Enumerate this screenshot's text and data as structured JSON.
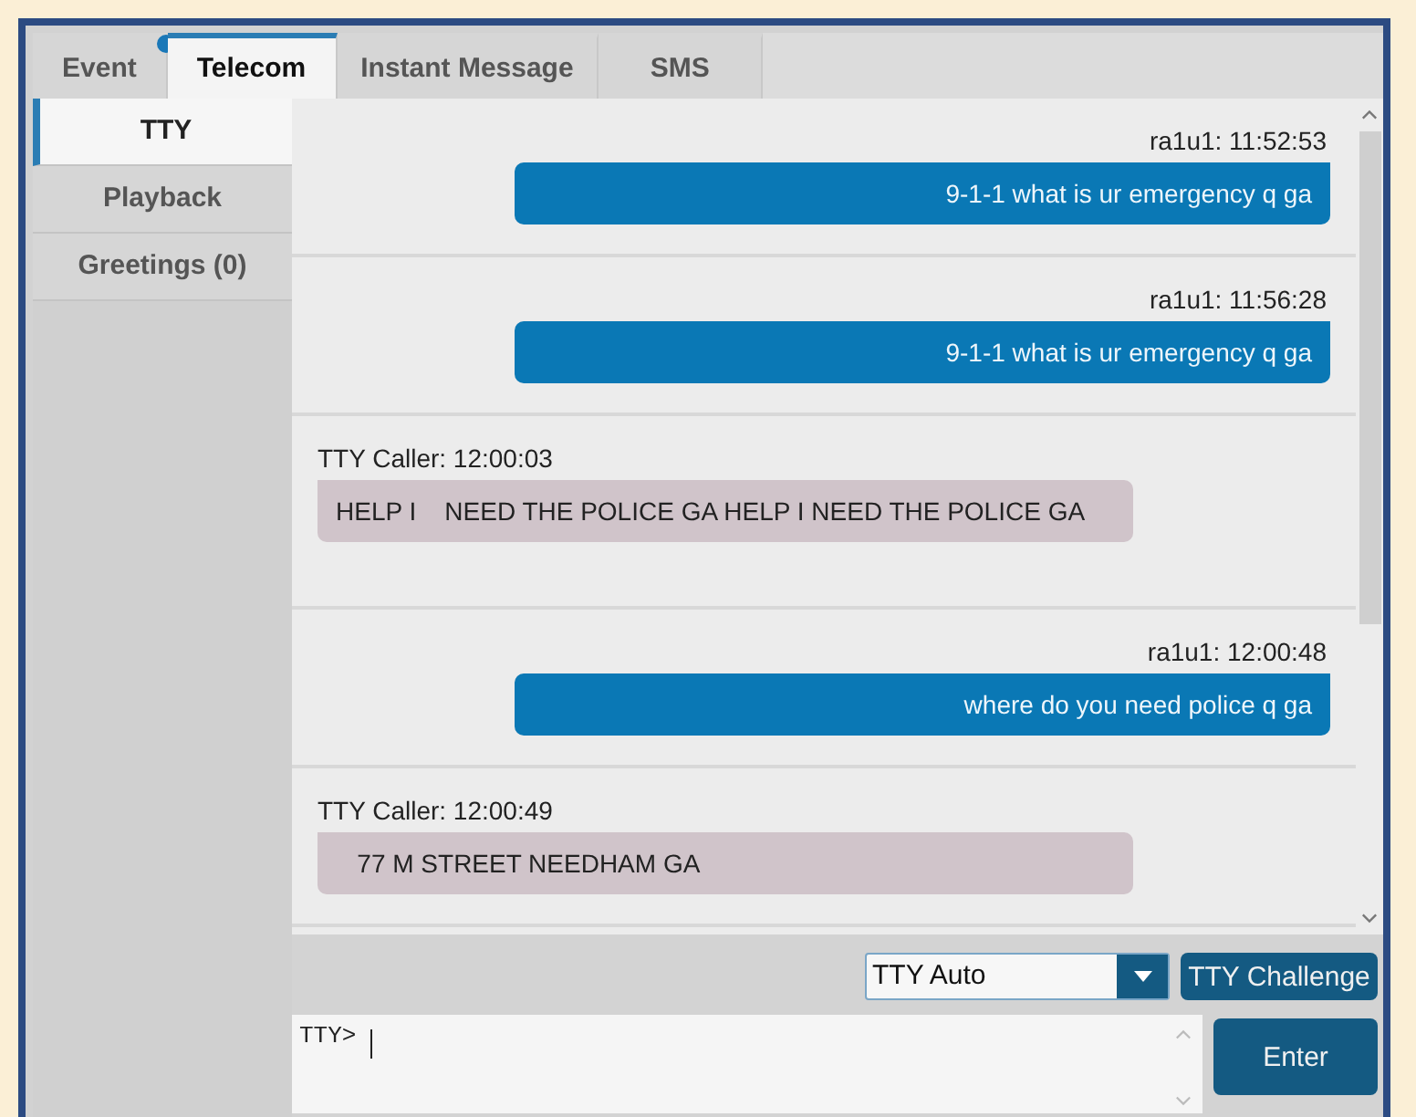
{
  "tabs": [
    {
      "label": "Event",
      "selected": false,
      "badge": true
    },
    {
      "label": "Telecom",
      "selected": true,
      "badge": false
    },
    {
      "label": "Instant Message",
      "selected": false,
      "badge": false
    },
    {
      "label": "SMS",
      "selected": false,
      "badge": false
    }
  ],
  "sidebar": {
    "items": [
      {
        "label": "TTY",
        "selected": true
      },
      {
        "label": "Playback",
        "selected": false
      },
      {
        "label": "Greetings (0)",
        "selected": false
      }
    ]
  },
  "messages": [
    {
      "kind": "outgoing",
      "sender": "ra1u1: 11:52:53",
      "text": "9-1-1 what is ur emergency q ga"
    },
    {
      "kind": "outgoing",
      "sender": "ra1u1: 11:56:28",
      "text": "9-1-1 what is ur emergency q ga"
    },
    {
      "kind": "incoming",
      "sender": "TTY Caller: 12:00:03",
      "text": "HELP I    NEED THE POLICE GA HELP I NEED THE POLICE GA"
    },
    {
      "kind": "outgoing",
      "sender": "ra1u1: 12:00:48",
      "text": "where do you need police q ga"
    },
    {
      "kind": "incoming",
      "sender": "TTY Caller: 12:00:49",
      "text": "   77 M STREET NEEDHAM GA"
    }
  ],
  "composer": {
    "mode": "TTY Auto",
    "challenge_button": "TTY Challenge",
    "prompt": "TTY>",
    "send_button": "Enter"
  }
}
